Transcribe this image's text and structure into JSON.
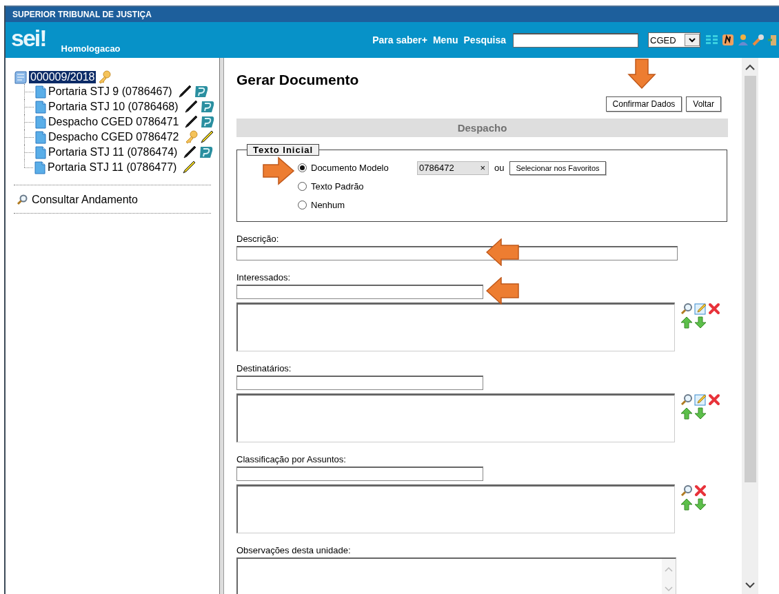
{
  "top_bar": {
    "title": "SUPERIOR TRIBUNAL DE JUSTIÇA"
  },
  "header": {
    "logo": "sei!",
    "environment": "Homologacao",
    "links": [
      "Para saber+",
      "Menu",
      "Pesquisa"
    ],
    "unit_select": {
      "value": "CGED"
    }
  },
  "tree": {
    "root": {
      "label": "000009/2018",
      "selected": true,
      "restricted": true
    },
    "children": [
      {
        "label": "Portaria STJ 9 (0786467)",
        "signed": true,
        "restricted": false
      },
      {
        "label": "Portaria STJ 10 (0786468)",
        "signed": true,
        "restricted": false
      },
      {
        "label": "Despacho CGED 0786471",
        "signed": true,
        "restricted": false
      },
      {
        "label": "Despacho CGED 0786472",
        "signed": false,
        "restricted": true
      },
      {
        "label": "Portaria STJ 11 (0786474)",
        "signed": true,
        "restricted": false
      },
      {
        "label": "Portaria STJ 11 (0786477)",
        "signed": false,
        "restricted": false
      }
    ]
  },
  "sidebar_actions": [
    {
      "label": "Consultar Andamento"
    }
  ],
  "page": {
    "title": "Gerar Documento",
    "buttons": [
      {
        "label": "Confirmar Dados",
        "pointed": true
      },
      {
        "label": "Voltar",
        "pointed": false
      }
    ],
    "section_title": "Despacho",
    "initial_text": {
      "legend": "Texto Inicial",
      "options": [
        {
          "label": "Documento Modelo",
          "selected": true,
          "pointed": true,
          "model_value": "0786472",
          "clear": "×",
          "or": "ou",
          "favorites_button": "Selecionar nos Favoritos"
        },
        {
          "label": "Texto Padrão",
          "selected": false,
          "pointed": false
        },
        {
          "label": "Nenhum",
          "selected": false,
          "pointed": false
        }
      ]
    },
    "fields": [
      {
        "kind": "text",
        "label": "Descrição:",
        "pointed": true
      },
      {
        "kind": "picker",
        "label": "Interessados:",
        "pointed": true,
        "editable": true
      },
      {
        "kind": "picker",
        "label": "Destinatários:",
        "pointed": false,
        "editable": true
      },
      {
        "kind": "picker",
        "label": "Classificação por Assuntos:",
        "pointed": false,
        "editable": false
      },
      {
        "kind": "textarea",
        "label": "Observações desta unidade:"
      }
    ]
  }
}
